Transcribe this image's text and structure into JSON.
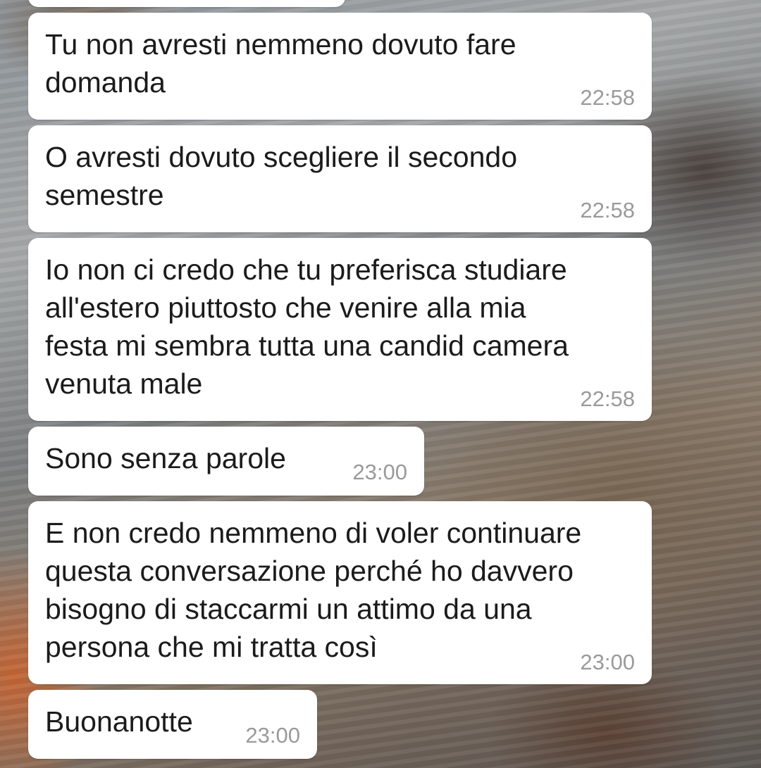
{
  "messages": [
    {
      "text": "Tu non avresti nemmeno dovuto fare\ndomanda",
      "time": "22:58"
    },
    {
      "text": "O avresti dovuto scegliere il secondo\nsemestre",
      "time": "22:58"
    },
    {
      "text": "Io non ci credo che tu preferisca studiare\nall'estero piuttosto che venire alla mia\nfesta mi sembra tutta una candid camera\nvenuta male",
      "time": "22:58"
    },
    {
      "text": "Sono senza parole",
      "time": "23:00"
    },
    {
      "text": "E non credo nemmeno di voler continuare\nquesta conversazione perché ho davvero\nbisogno di staccarmi un attimo da una\npersona che mi tratta così",
      "time": "23:00"
    },
    {
      "text": "Buonanotte",
      "time": "23:00"
    }
  ]
}
